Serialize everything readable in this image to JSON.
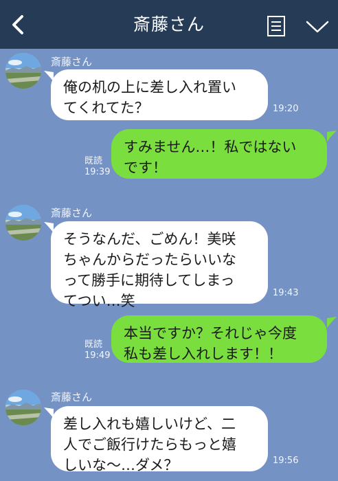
{
  "header": {
    "title": "斎藤さん",
    "back_icon": "chevron-left-icon",
    "note_icon": "note-icon",
    "menu_icon": "chevron-down-icon",
    "background": "#263b56"
  },
  "chat": {
    "background": "#7492c4",
    "incoming_bubble_color": "#ffffff",
    "outgoing_bubble_color": "#7ade3f",
    "messages": [
      {
        "direction": "in",
        "sender": "斎藤さん",
        "text": "俺の机の上に差し入れ置い\nてくれてた？",
        "time": "19:20"
      },
      {
        "direction": "out",
        "text": "すみません…！私ではない\nです！",
        "read": "既読",
        "time": "19:39"
      },
      {
        "direction": "in",
        "sender": "斎藤さん",
        "text": "そうなんだ、ごめん！美咲\nちゃんからだったらいいな\nって勝手に期待してしまっ\nてつい…笑",
        "time": "19:43"
      },
      {
        "direction": "out",
        "text": "本当ですか？それじゃ今度\n私も差し入れします！！",
        "read": "既読",
        "time": "19:49"
      },
      {
        "direction": "in",
        "sender": "斎藤さん",
        "text": "差し入れも嬉しいけど、二\n人でご飯行けたらもっと嬉\nしいな〜…ダメ？",
        "time": "19:56"
      }
    ]
  }
}
